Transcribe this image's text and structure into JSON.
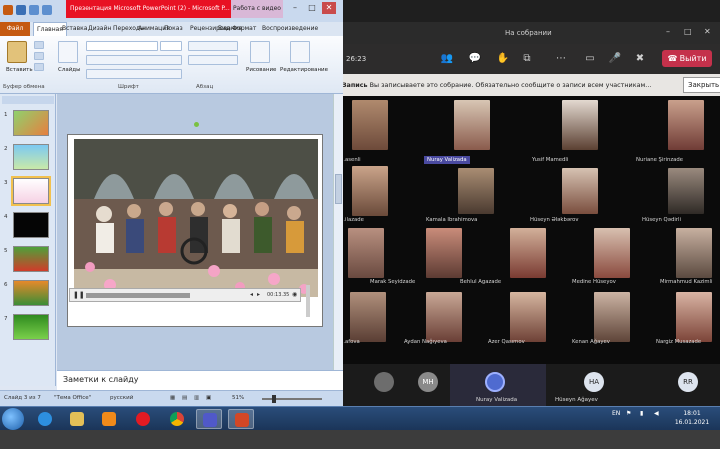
{
  "teams": {
    "title": "На собрании",
    "timer": "26:23",
    "leave_label": "Выйти",
    "recording_bold": "Запись",
    "recording_text": "Вы записываете это собрание. Обязательно сообщите о записи всем участникам...",
    "recording_close": "Закрыть",
    "participants": [
      {
        "name": "...asenli"
      },
      {
        "name": "Nuray Valizada",
        "highlight": true
      },
      {
        "name": "Yusif Mamedli"
      },
      {
        "name": "Nuriane Şirinzade"
      },
      {
        "name": "...ilazade"
      },
      {
        "name": "Kamala Ibrahimova"
      },
      {
        "name": "Hüseyn Ələkbərov"
      },
      {
        "name": "Hüseyn Qədirli"
      },
      {
        "name": "Marak Seyidzade"
      },
      {
        "name": "Behlul Agazade"
      },
      {
        "name": "Medine Hüseyov"
      },
      {
        "name": "Mirmahmud Kazimli"
      },
      {
        "name": "...afova"
      },
      {
        "name": "Aydan Nağıyeva"
      },
      {
        "name": "Azer Qasımov"
      },
      {
        "name": "Kenan Ağayev"
      },
      {
        "name": "Nargiz Musazade"
      }
    ],
    "strip": [
      {
        "initials": "MH"
      },
      {
        "name": "Nuray Valizada"
      },
      {
        "initials": "HA",
        "name": "Hüseyn Ağayev"
      },
      {
        "initials": "RR"
      }
    ]
  },
  "ppt": {
    "doc_title": "Презентация Microsoft PowerPoint (2) - Microsoft P...",
    "context_tab": "Работа с видео",
    "tabs": [
      "Файл",
      "Главная",
      "Вставка",
      "Дизайн",
      "Переходы",
      "Анимация",
      "Показ",
      "Рецензирование",
      "Вид",
      "Формат",
      "Воспроизведение"
    ],
    "ribbon": {
      "paste": "Вставить",
      "slides": "Слайды",
      "clipboard_group": "Буфер обмена",
      "font_group": "Шрифт",
      "paragraph_group": "Абзац",
      "drawing": "Рисование",
      "editing": "Редактирование"
    },
    "slide_numbers": [
      "1",
      "2",
      "3",
      "4",
      "5",
      "6",
      "7"
    ],
    "video_time": "00:13.35",
    "notes_placeholder": "Заметки к слайду",
    "status": {
      "slide_info": "Слайд 3 из 7",
      "theme": "\"Тема Office\"",
      "language": "русский",
      "zoom": "51%"
    }
  },
  "taskbar": {
    "lang": "EN",
    "time": "18:01",
    "date": "16.01.2021"
  },
  "colors": {
    "teams_leave": "#c4314b",
    "ppt_title_red": "#e81123",
    "file_tab": "#c55a11",
    "taskbar": "#1b3559"
  }
}
